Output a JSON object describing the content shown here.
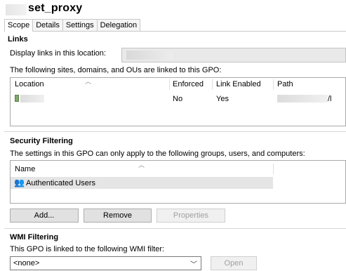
{
  "window": {
    "title": "set_proxy"
  },
  "tabs": [
    {
      "label": "Scope",
      "active": true
    },
    {
      "label": "Details"
    },
    {
      "label": "Settings"
    },
    {
      "label": "Delegation"
    }
  ],
  "links": {
    "section_title": "Links",
    "display_label": "Display links in this location:",
    "linked_text": "The following sites, domains, and OUs are linked to this GPO:",
    "columns": [
      "Location",
      "Enforced",
      "Link Enabled",
      "Path"
    ],
    "rows": [
      {
        "location": "",
        "enforced": "No",
        "link_enabled": "Yes",
        "path": "/l"
      }
    ]
  },
  "security_filtering": {
    "section_title": "Security Filtering",
    "description": "The settings in this GPO can only apply to the following groups, users, and computers:",
    "columns": [
      "Name"
    ],
    "rows": [
      {
        "name": "Authenticated Users"
      }
    ],
    "buttons": {
      "add": "Add...",
      "remove": "Remove",
      "properties": "Properties"
    }
  },
  "wmi_filtering": {
    "section_title": "WMI Filtering",
    "description": "This GPO is linked to the following WMI filter:",
    "selected": "<none>",
    "open_button": "Open"
  },
  "colors": {
    "selected_row": "#e5e5e5",
    "disabled_text": "#a0a0a0"
  }
}
